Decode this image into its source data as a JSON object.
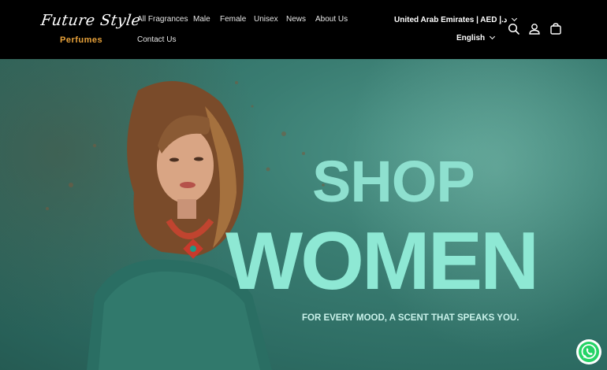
{
  "brand": {
    "logo_script": "Future Style",
    "logo_sub": "Perfumes"
  },
  "nav": {
    "items": [
      {
        "label": "All Fragrances"
      },
      {
        "label": "Male"
      },
      {
        "label": "Female"
      },
      {
        "label": "Unisex"
      },
      {
        "label": "News"
      },
      {
        "label": "About Us"
      },
      {
        "label": "Contact Us"
      }
    ]
  },
  "locale": {
    "country": "United Arab Emirates | AED د.إ",
    "language": "English"
  },
  "icons": [
    "search-icon",
    "account-icon",
    "cart-icon",
    "whatsapp-icon"
  ],
  "hero": {
    "line1": "SHOP",
    "line2": "WOMEN",
    "tagline": "FOR EVERY MOOD, A SCENT THAT SPEAKS YOU."
  },
  "colors": {
    "header_bg": "#000000",
    "hero_bg": "#3a7d72",
    "hero_text": "#8ee0cf",
    "logo_accent": "#e8a23a",
    "whatsapp": "#25d366"
  }
}
